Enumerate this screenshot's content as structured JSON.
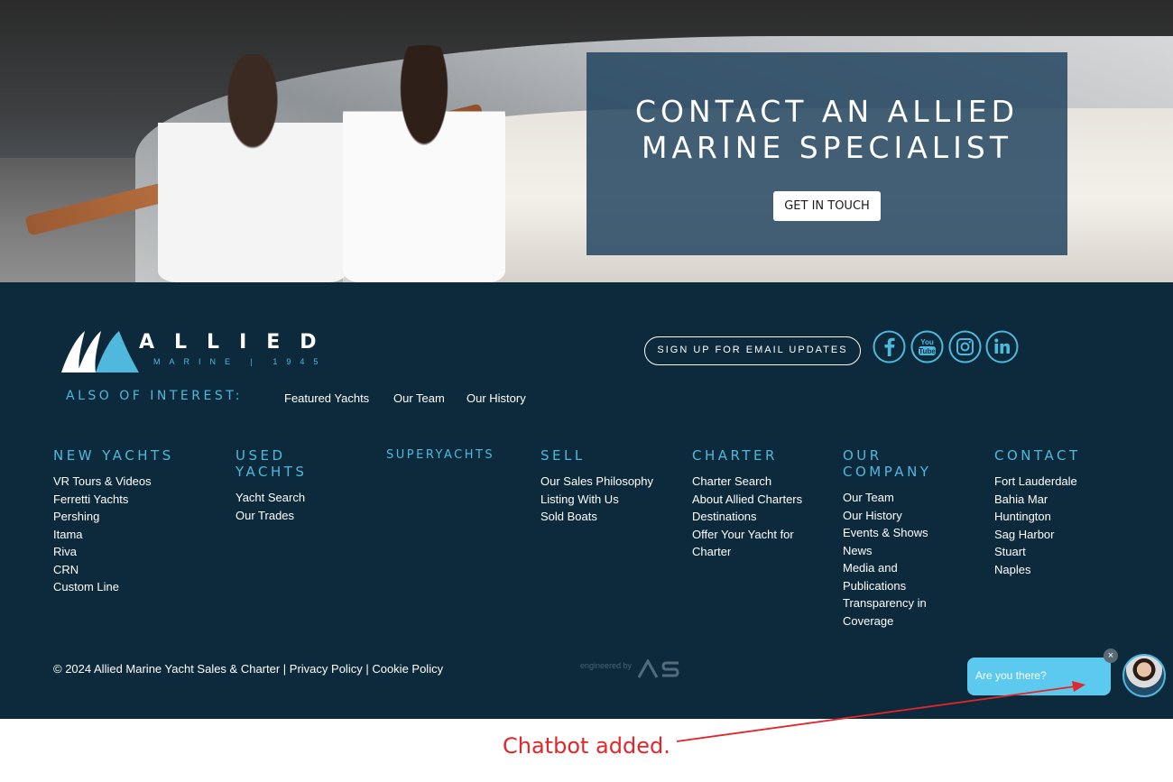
{
  "hero": {
    "title": "CONTACT AN ALLIED MARINE SPECIALIST",
    "button_label": "GET IN TOUCH"
  },
  "logo": {
    "word": "ALLIED",
    "subtitle": "MARINE | 1945"
  },
  "also_of_interest": {
    "label": "ALSO OF INTEREST:",
    "links": [
      "Featured Yachts",
      "Our Team",
      "Our History"
    ]
  },
  "email_button_label": "SIGN UP FOR EMAIL UPDATES",
  "social_icons": [
    "facebook-icon",
    "youtube-icon",
    "instagram-icon",
    "linkedin-icon"
  ],
  "columns": [
    {
      "heading": "NEW YACHTS",
      "items": [
        "VR Tours & Videos",
        "Ferretti Yachts",
        "Pershing",
        "Itama",
        "Riva",
        "CRN",
        "Custom Line"
      ]
    },
    {
      "heading": "USED YACHTS",
      "items": [
        "Yacht Search",
        "Our Trades"
      ]
    },
    {
      "heading": "SUPERYACHTS",
      "items": []
    },
    {
      "heading": "SELL",
      "items": [
        "Our Sales Philosophy",
        "Listing With Us",
        "Sold Boats"
      ]
    },
    {
      "heading": "CHARTER",
      "items": [
        "Charter Search",
        "About Allied Charters",
        "Destinations",
        "Offer Your Yacht for Charter"
      ]
    },
    {
      "heading": "OUR COMPANY",
      "items": [
        "Our Team",
        "Our History",
        "Events & Shows",
        "News",
        "Media and Publications",
        "Transparency in Coverage"
      ]
    },
    {
      "heading": "CONTACT",
      "items": [
        "Fort Lauderdale",
        "Bahia Mar",
        "Huntington",
        "Sag Harbor",
        "Stuart",
        "Naples"
      ]
    }
  ],
  "copyright": {
    "text": "© 2024 Allied Marine Yacht Sales & Charter",
    "sep": " | ",
    "privacy": "Privacy Policy",
    "cookie": "Cookie Policy"
  },
  "engineered": {
    "text": "engineered by",
    "mark": "AS"
  },
  "chatbot": {
    "message": "Are you there?",
    "close": "×"
  },
  "annotation": "Chatbot added.",
  "colors": {
    "footer_bg": "#0d2a3c",
    "accent": "#4fb8dc",
    "panel": "#1c3f5c",
    "chat": "#5cc9ee",
    "annotation": "#e2262a"
  }
}
